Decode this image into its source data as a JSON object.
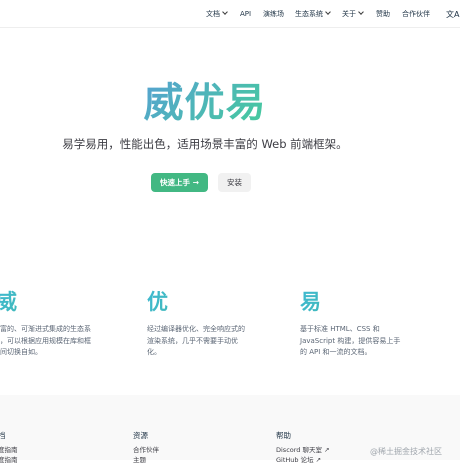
{
  "nav": {
    "items": [
      {
        "label": "文档",
        "has_caret": true
      },
      {
        "label": "API",
        "has_caret": false
      },
      {
        "label": "演练场",
        "has_caret": false
      },
      {
        "label": "生态系统",
        "has_caret": true
      },
      {
        "label": "关于",
        "has_caret": true
      },
      {
        "label": "赞助",
        "has_caret": false
      },
      {
        "label": "合作伙伴",
        "has_caret": false
      }
    ],
    "language_icon": "translate-icon",
    "language_glyph": "文A"
  },
  "hero": {
    "title": "威优易",
    "tagline": "易学易用，性能出色，适用场景丰富的 Web 前端框架。",
    "primary_button": "快速上手 →",
    "secondary_button": "安装"
  },
  "features": [
    {
      "title": "威",
      "desc": "富的、可渐进式集成的生态系\n，可以根据应用规模在库和框\n间切换自如。"
    },
    {
      "title": "优",
      "desc": "经过编译器优化、完全响应式的\n渲染系统，几乎不需要手动优\n化。"
    },
    {
      "title": "易",
      "desc": "基于标准 HTML、CSS 和\nJavaScript 构建，提供容易上手\n的 API 和一流的文档。"
    }
  ],
  "footer": {
    "columns": [
      {
        "title": "档",
        "links": [
          "度指南",
          "度指南"
        ]
      },
      {
        "title": "资源",
        "links": [
          "合作伙伴",
          "主题"
        ]
      },
      {
        "title": "帮助",
        "links": [
          "Discord 聊天室 ↗",
          "GitHub 论坛 ↗"
        ]
      }
    ]
  },
  "watermark": "@稀土掘金技术社区",
  "colors": {
    "brand_green": "#42b883",
    "gradient_start": "#42d392",
    "gradient_end": "#647eff"
  }
}
